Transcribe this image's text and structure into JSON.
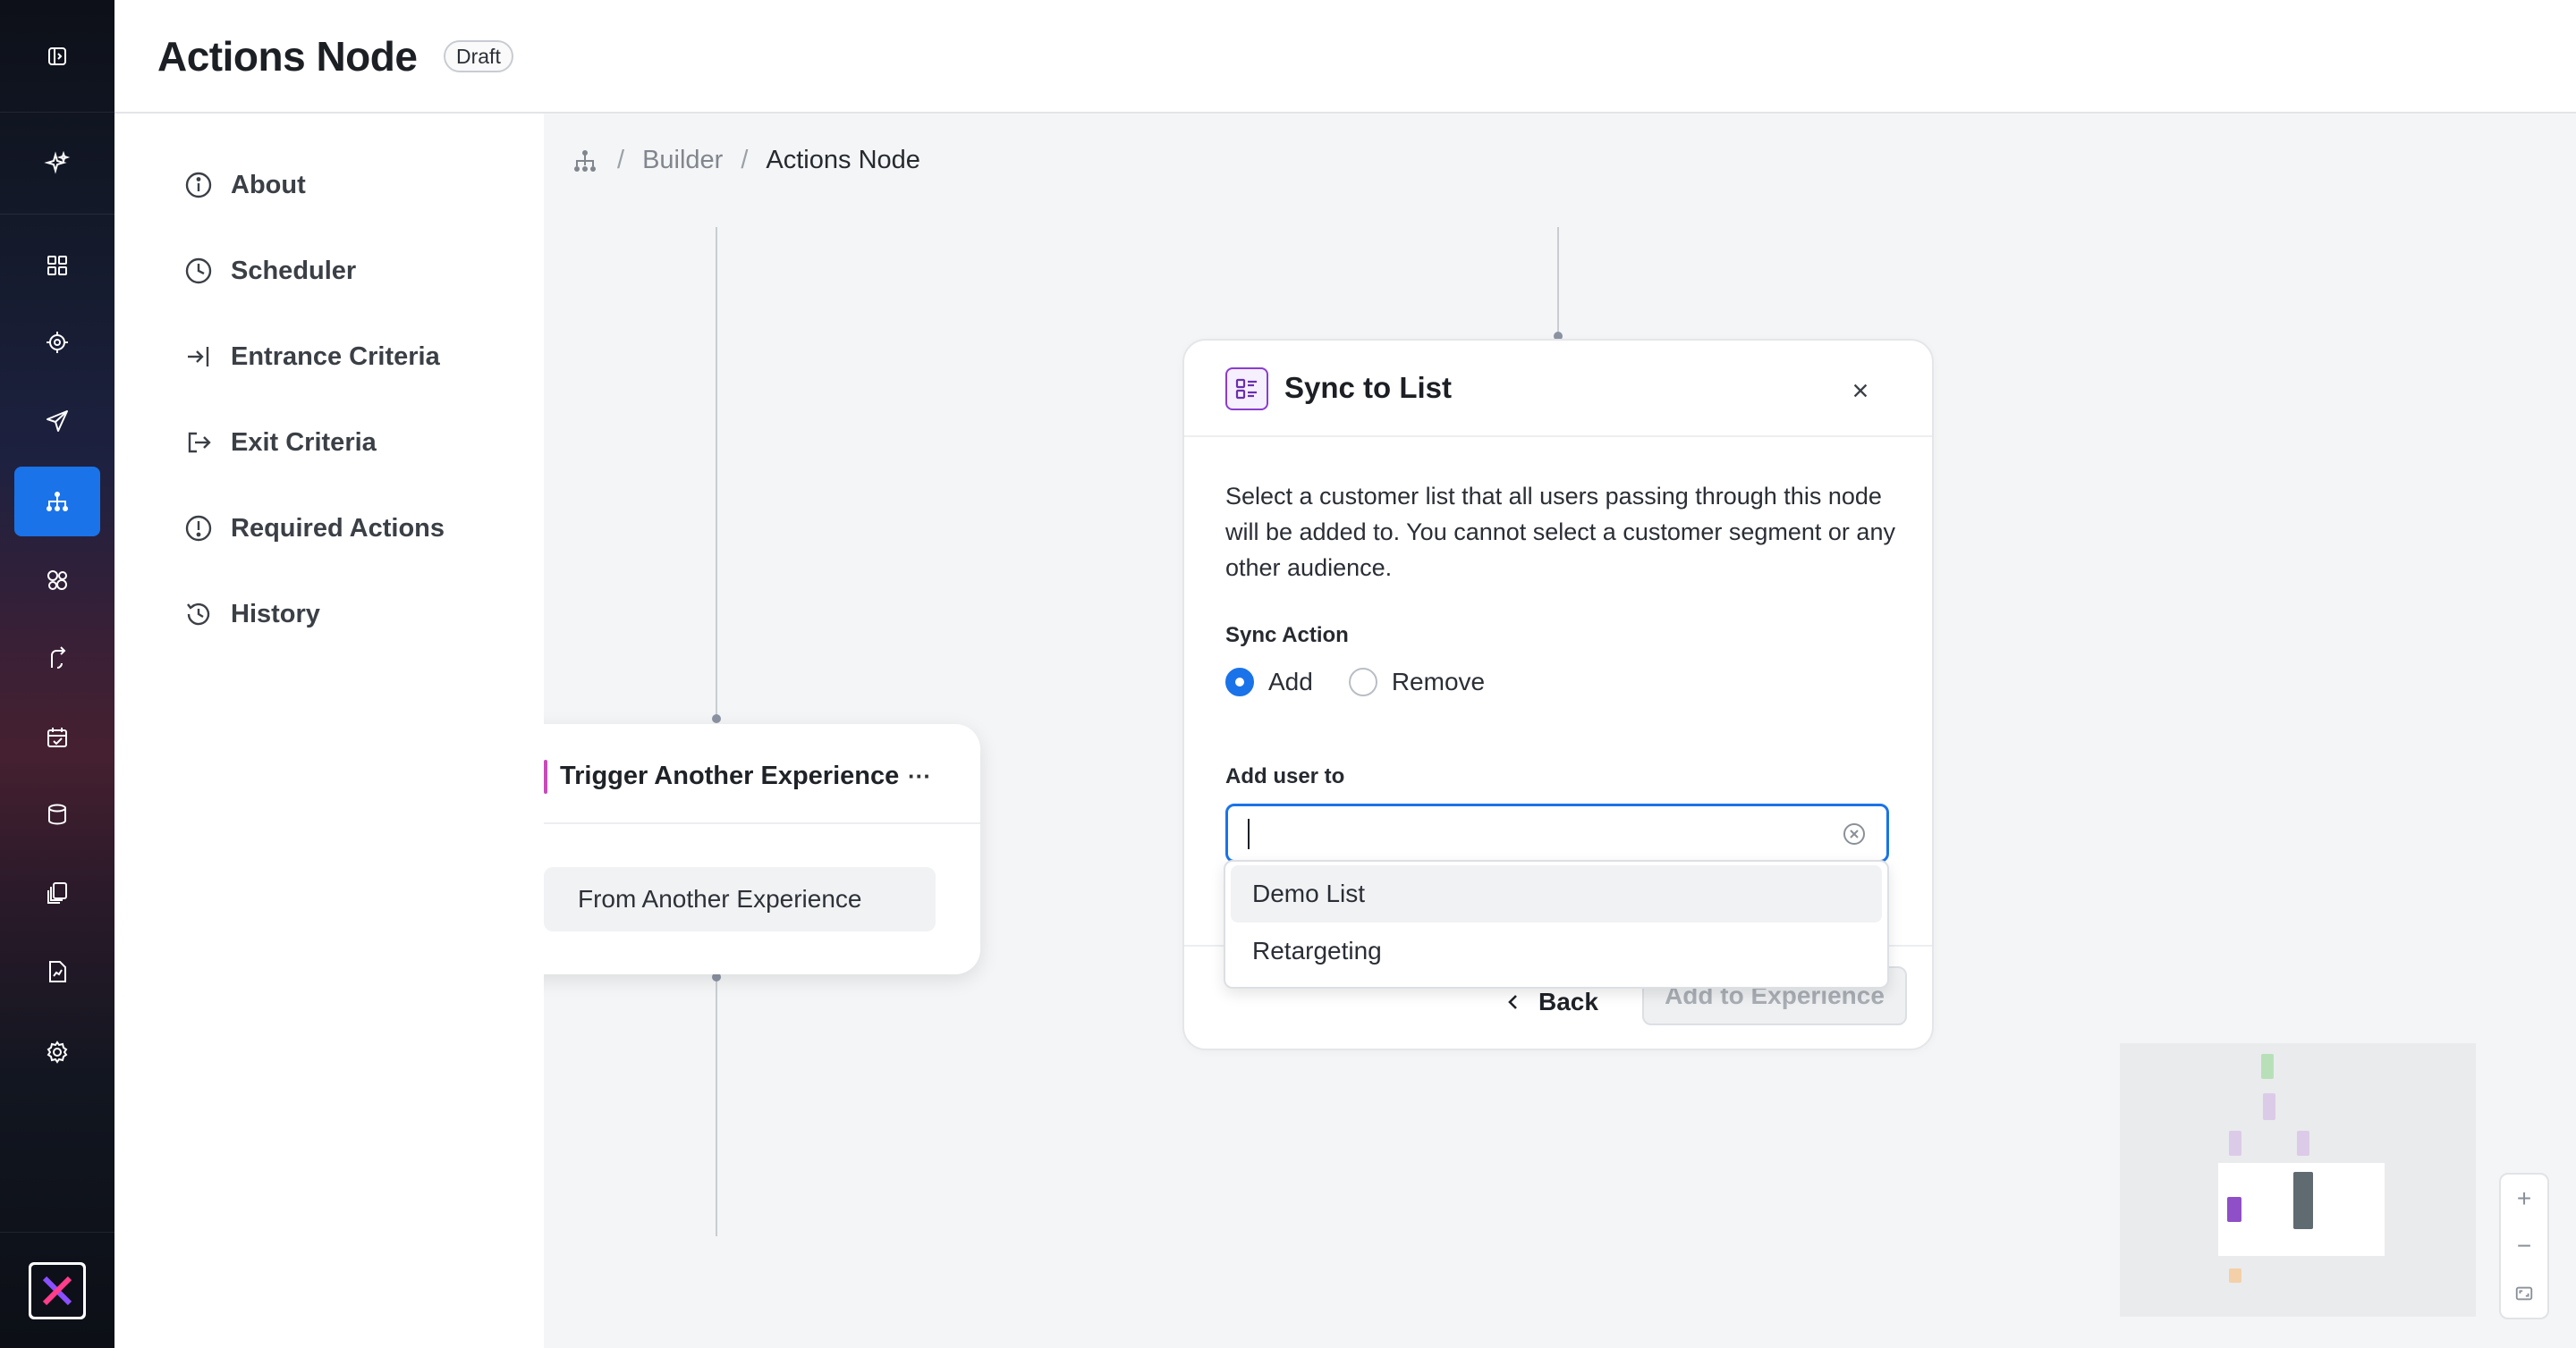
{
  "header": {
    "title": "Actions Node",
    "status_badge": "Draft"
  },
  "rail": {
    "items": [
      {
        "icon": "sidebar-toggle-icon"
      },
      {
        "icon": "sparkle-icon"
      },
      {
        "icon": "dashboard-icon"
      },
      {
        "icon": "target-icon"
      },
      {
        "icon": "send-icon"
      },
      {
        "icon": "hierarchy-icon",
        "active": true
      },
      {
        "icon": "segments-icon"
      },
      {
        "icon": "journey-icon"
      },
      {
        "icon": "calendar-icon"
      },
      {
        "icon": "database-icon"
      },
      {
        "icon": "library-icon"
      },
      {
        "icon": "report-icon"
      },
      {
        "icon": "settings-icon"
      }
    ],
    "accent_color": "#1a73e8"
  },
  "sidenav": {
    "items": [
      {
        "label": "About",
        "icon": "info-icon"
      },
      {
        "label": "Scheduler",
        "icon": "clock-icon"
      },
      {
        "label": "Entrance Criteria",
        "icon": "enter-icon"
      },
      {
        "label": "Exit Criteria",
        "icon": "exit-icon"
      },
      {
        "label": "Required Actions",
        "icon": "alert-icon"
      },
      {
        "label": "History",
        "icon": "history-icon"
      }
    ]
  },
  "breadcrumb": {
    "sep": "/",
    "builder": "Builder",
    "current": "Actions Node"
  },
  "trigger_card": {
    "title": "Trigger Another Experience",
    "more": "···",
    "option": "From Another Experience"
  },
  "panel": {
    "title": "Sync to List",
    "description": "Select a customer list that all users passing through this node will be added to. You cannot select a customer segment or any other audience.",
    "sync_action_label": "Sync Action",
    "options": [
      {
        "label": "Add",
        "checked": true
      },
      {
        "label": "Remove",
        "checked": false
      }
    ],
    "add_user_label": "Add user to",
    "search_value": "",
    "back_label": "Back",
    "submit_label": "Add to Experience"
  },
  "dropdown": {
    "options": [
      "Demo List",
      "Retargeting"
    ]
  },
  "zoom": {
    "in": "+",
    "out": "−"
  }
}
